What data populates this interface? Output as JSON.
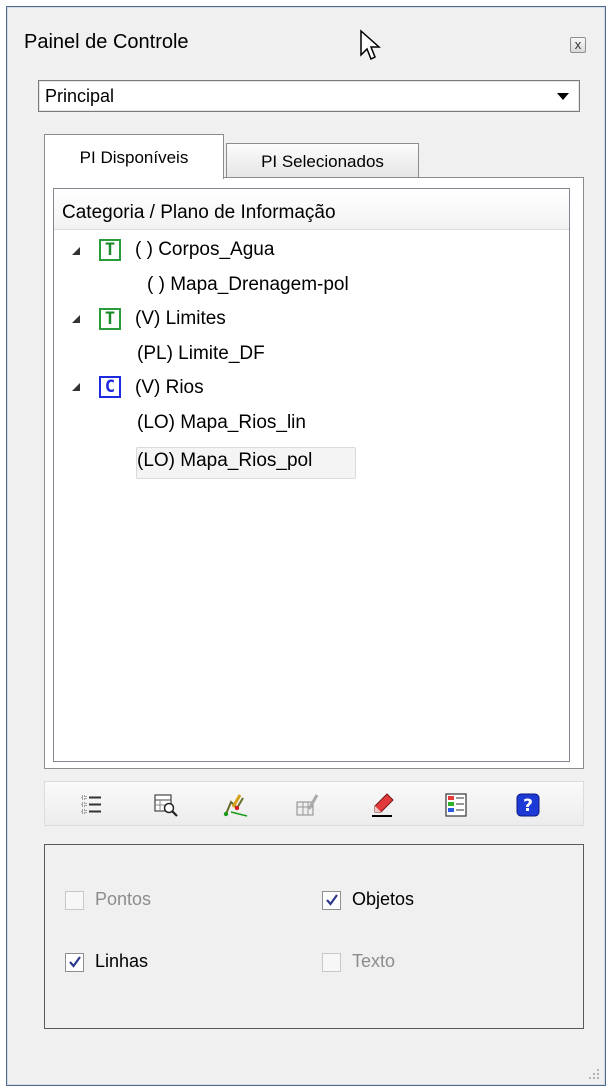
{
  "window": {
    "title": "Painel de Controle",
    "close_glyph": "x"
  },
  "dropdown": {
    "value": "Principal"
  },
  "tabs": [
    {
      "label": "PI Disponíveis",
      "active": true
    },
    {
      "label": "PI Selecionados",
      "active": false
    }
  ],
  "tree": {
    "header": "Categoria / Plano de Informação",
    "items": [
      {
        "type": "category",
        "badge": "T",
        "label": "( ) Corpos_Agua"
      },
      {
        "type": "layer",
        "label": "( ) Mapa_Drenagem-pol"
      },
      {
        "type": "category",
        "badge": "T",
        "label": "(V) Limites"
      },
      {
        "type": "layer",
        "label": "(PL) Limite_DF"
      },
      {
        "type": "category",
        "badge": "C",
        "label": "(V) Rios"
      },
      {
        "type": "layer",
        "label": "(LO) Mapa_Rios_lin"
      },
      {
        "type": "layer",
        "label": "(LO) Mapa_Rios_pol",
        "selected": true
      }
    ]
  },
  "toolbar": {
    "icons": [
      "list-icon",
      "zoom-table-icon",
      "edit-vector-icon",
      "table-edit-icon",
      "eraser-pencil-icon",
      "legend-color-icon",
      "help-icon"
    ]
  },
  "options": {
    "pontos": {
      "label": "Pontos",
      "checked": false,
      "enabled": false
    },
    "objetos": {
      "label": "Objetos",
      "checked": true,
      "enabled": true
    },
    "linhas": {
      "label": "Linhas",
      "checked": true,
      "enabled": true
    },
    "texto": {
      "label": "Texto",
      "checked": false,
      "enabled": false
    }
  },
  "colors": {
    "category_t": "#2a9d3a",
    "category_c": "#1d2ae0",
    "help_blue": "#1e3ad6"
  }
}
